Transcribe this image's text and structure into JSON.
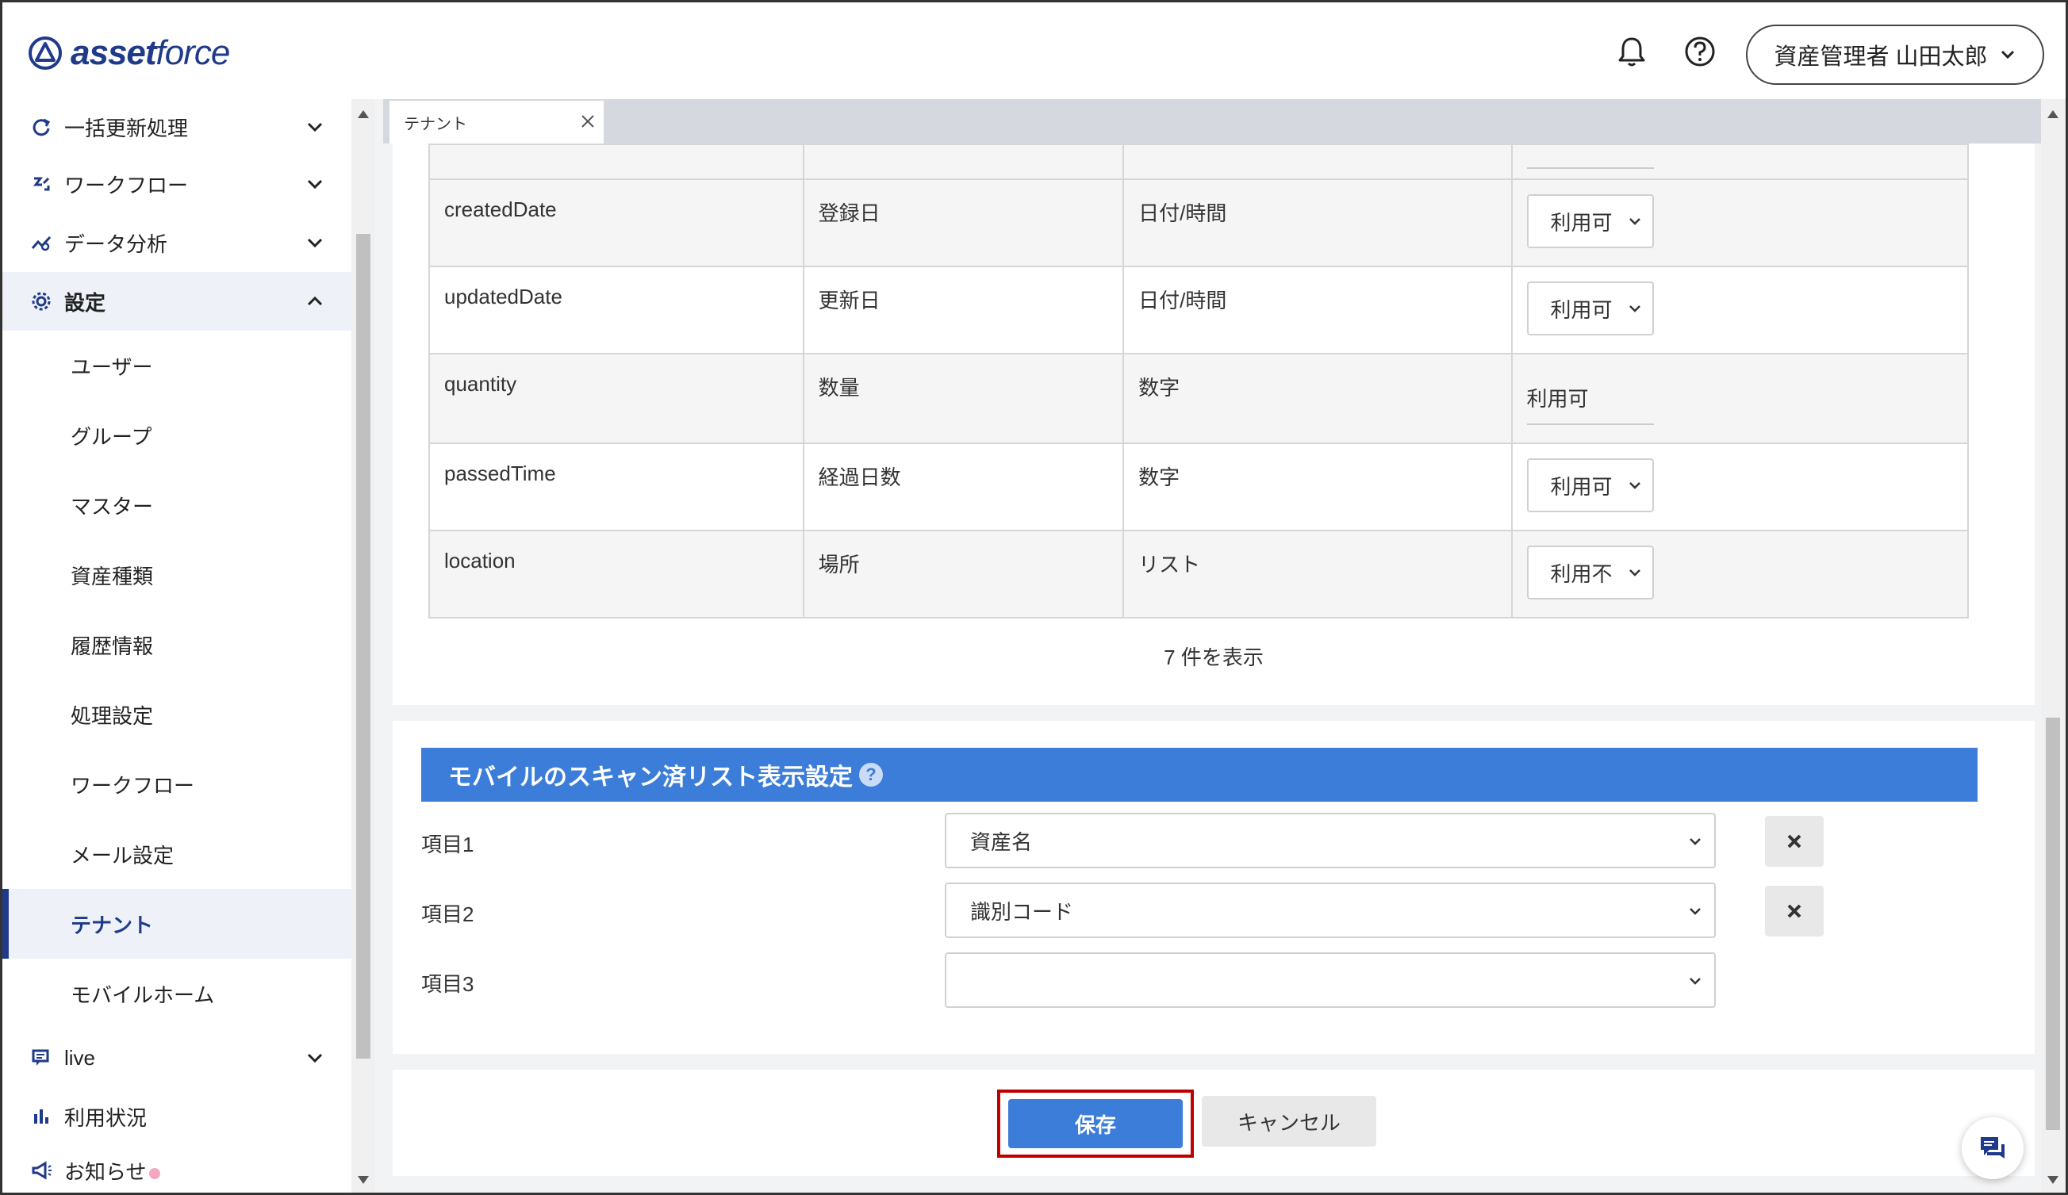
{
  "header": {
    "logo_bold": "asset",
    "logo_light": "force",
    "user_label": "資産管理者 山田太郎"
  },
  "sidebar": {
    "items": [
      {
        "label": "一括更新処理",
        "icon": "refresh-icon"
      },
      {
        "label": "ワークフロー",
        "icon": "workflow-icon"
      },
      {
        "label": "データ分析",
        "icon": "analytics-icon"
      },
      {
        "label": "設定",
        "icon": "gear-icon"
      }
    ],
    "sub_items": [
      {
        "label": "ユーザー"
      },
      {
        "label": "グループ"
      },
      {
        "label": "マスター"
      },
      {
        "label": "資産種類"
      },
      {
        "label": "履歴情報"
      },
      {
        "label": "処理設定"
      },
      {
        "label": "ワークフロー"
      },
      {
        "label": "メール設定"
      },
      {
        "label": "テナント"
      },
      {
        "label": "モバイルホーム"
      }
    ],
    "bottom_items": [
      {
        "label": "live",
        "icon": "chat-icon"
      },
      {
        "label": "利用状況",
        "icon": "bar-chart-icon"
      },
      {
        "label": "お知らせ",
        "icon": "megaphone-icon"
      }
    ]
  },
  "tab": {
    "label": "テナント"
  },
  "table": {
    "rows": [
      {
        "key": "createdDate",
        "name": "登録日",
        "type": "日付/時間",
        "status": "利用可",
        "editable": true
      },
      {
        "key": "updatedDate",
        "name": "更新日",
        "type": "日付/時間",
        "status": "利用可",
        "editable": true
      },
      {
        "key": "quantity",
        "name": "数量",
        "type": "数字",
        "status": "利用可",
        "editable": false
      },
      {
        "key": "passedTime",
        "name": "経過日数",
        "type": "数字",
        "status": "利用可",
        "editable": true
      },
      {
        "key": "location",
        "name": "場所",
        "type": "リスト",
        "status": "利用不",
        "editable": true
      }
    ],
    "count_text": "7 件を表示"
  },
  "mobile_section": {
    "title": "モバイルのスキャン済リスト表示設定",
    "help": "?",
    "fields": [
      {
        "label": "項目1",
        "value": "資産名"
      },
      {
        "label": "項目2",
        "value": "識別コード"
      },
      {
        "label": "項目3",
        "value": ""
      }
    ]
  },
  "actions": {
    "save": "保存",
    "cancel": "キャンセル"
  },
  "colors": {
    "brand": "#1f3a8a",
    "accent": "#3b7dd8",
    "highlight": "#c00000"
  }
}
